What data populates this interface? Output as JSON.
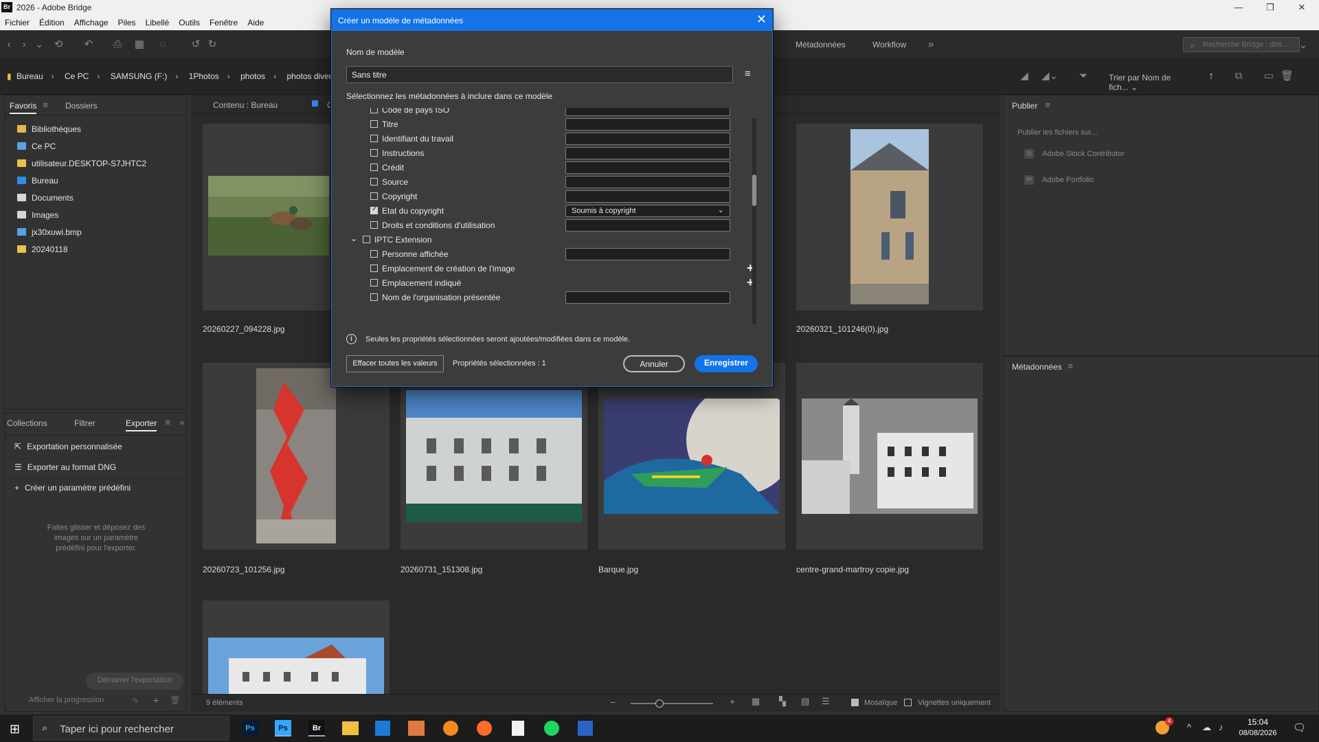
{
  "window": {
    "title": "2026 - Adobe Bridge",
    "logo": "Br",
    "controls": [
      "minimize-icon",
      "restore-icon",
      "close-icon"
    ]
  },
  "menu": [
    "Fichier",
    "Édition",
    "Affichage",
    "Piles",
    "Libellé",
    "Outils",
    "Fenêtre",
    "Aide"
  ],
  "workspaces": [
    "Métadonnées",
    "Workflow"
  ],
  "search_placeholder": "Recherche Bridge : dos...",
  "breadcrumb": [
    "Bureau",
    "Ce PC",
    "SAMSUNG (F:)",
    "1Photos",
    "photos",
    "photos diverse"
  ],
  "sort_label": "Trier par Nom de fich...",
  "left_panel": {
    "tabs": [
      "Favoris",
      "Dossiers"
    ],
    "favorites": [
      {
        "label": "Bibliothèques",
        "color": "#e8b64a"
      },
      {
        "label": "Ce PC",
        "color": "#5aa0e6"
      },
      {
        "label": "utilisateur.DESKTOP-S7JHTC2",
        "color": "#e8c24a"
      },
      {
        "label": "Bureau",
        "color": "#2d8ee6"
      },
      {
        "label": "Documents",
        "color": "#d6d6d6"
      },
      {
        "label": "Images",
        "color": "#d6d6d6"
      },
      {
        "label": "jx30xuwi.bmp",
        "color": "#5aa0e6"
      },
      {
        "label": "20240118",
        "color": "#e8c24a"
      }
    ]
  },
  "export_panel": {
    "tabs": [
      "Collections",
      "Filtrer",
      "Exporter"
    ],
    "items": [
      "Exportation personnalisée",
      "Exporter au format DNG",
      "Créer un paramètre prédéfini"
    ],
    "hint": [
      "Faites glisser et déposez des",
      "images sur un paramètre",
      "prédéfini pour l'exporter."
    ],
    "start_button": "Démarrer l'exportation",
    "progress_label": "Afficher la progression"
  },
  "content": {
    "tab_label": "Contenu : Bureau",
    "tab_label2": "C",
    "items": [
      {
        "name": "20260227_094228.jpg"
      },
      {
        "name": "20260321_101246(0).jpg"
      },
      {
        "name": "20260723_101256.jpg"
      },
      {
        "name": "20260731_151308.jpg"
      },
      {
        "name": "Barque.jpg"
      },
      {
        "name": "centre-grand-martroy copie.jpg"
      }
    ],
    "count": "9 éléments",
    "mosaic_label": "Mosaïque",
    "thumbs_only_label": "Vignettes uniquement"
  },
  "publish_panel": {
    "title": "Publier",
    "subtitle": "Publier les fichiers sur...",
    "services": [
      "Adobe Stock Contributor",
      "Adobe Portfolio"
    ]
  },
  "metadata_panel": {
    "title": "Métadonnées"
  },
  "dialog": {
    "title": "Créer un modèle de métadonnées",
    "name_label": "Nom de modèle",
    "name_value": "Sans titre",
    "select_label": "Sélectionnez les métadonnées à inclure dans ce modèle",
    "rows": [
      {
        "label": "Code de pays ISO",
        "checked": false,
        "field": "text"
      },
      {
        "label": "Titre",
        "checked": false,
        "field": "text"
      },
      {
        "label": "Identifiant du travail",
        "checked": false,
        "field": "text"
      },
      {
        "label": "Instructions",
        "checked": false,
        "field": "text"
      },
      {
        "label": "Crédit",
        "checked": false,
        "field": "text"
      },
      {
        "label": "Source",
        "checked": false,
        "field": "text"
      },
      {
        "label": "Copyright",
        "checked": false,
        "field": "text"
      },
      {
        "label": "Etat du copyright",
        "checked": true,
        "field": "select",
        "value": "Soumis à copyright"
      },
      {
        "label": "Droits et conditions d'utilisation",
        "checked": false,
        "field": "text"
      },
      {
        "label": "IPTC Extension",
        "checked": false,
        "field": "group"
      },
      {
        "label": "Personne affichée",
        "checked": false,
        "field": "text"
      },
      {
        "label": "Emplacement de création de l'image",
        "checked": false,
        "field": "plus"
      },
      {
        "label": "Emplacement indiqué",
        "checked": false,
        "field": "plus"
      },
      {
        "label": "Nom de l'organisation présentée",
        "checked": false,
        "field": "text"
      }
    ],
    "info_text": "Seules les propriétés sélectionnées seront ajoutées/modifiées dans ce modèle.",
    "clear_button": "Effacer toutes les valeurs",
    "selected_count": "Propriétés sélectionnées : 1",
    "cancel_button": "Annuler",
    "save_button": "Enregistrer"
  },
  "taskbar": {
    "search_placeholder": "Taper ici pour rechercher",
    "apps": [
      "Ps",
      "Ps",
      "Br",
      "explorer",
      "store",
      "photos",
      "paint",
      "firefox",
      "notepad",
      "spotify",
      "word"
    ],
    "time": "15:04",
    "date": "08/08/2026",
    "badge": "4"
  }
}
